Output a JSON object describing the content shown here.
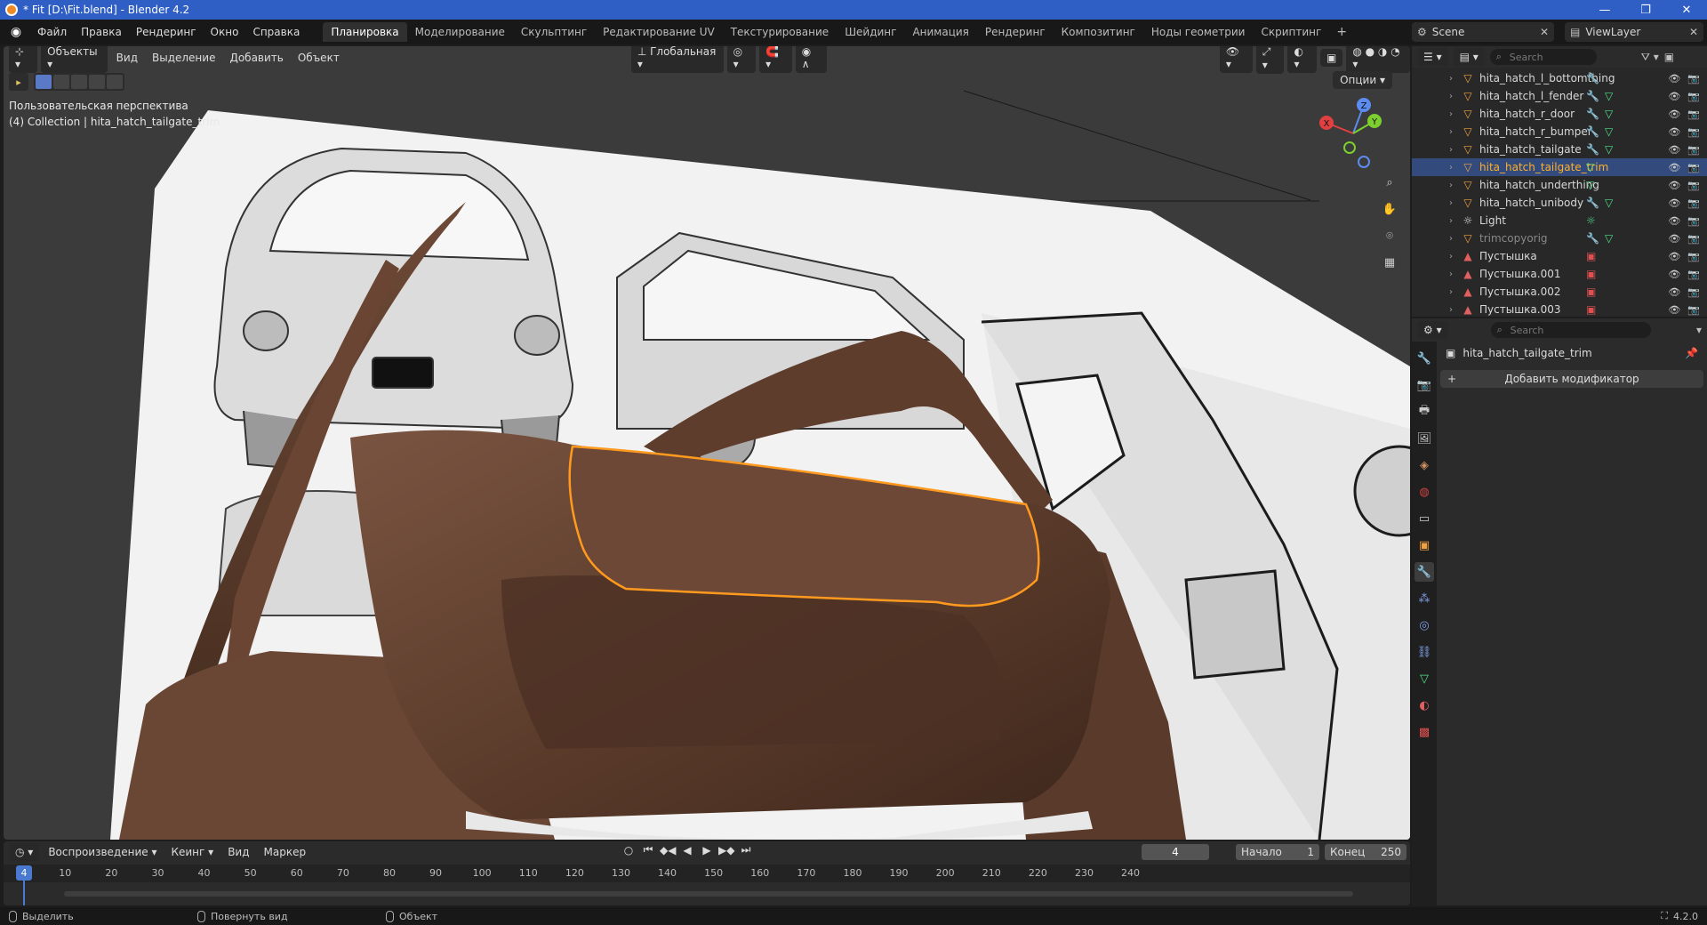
{
  "window": {
    "title": "* Fit [D:\\Fit.blend] - Blender 4.2",
    "controls": [
      "—",
      "❐",
      "✕"
    ]
  },
  "menu": [
    "Файл",
    "Правка",
    "Рендеринг",
    "Окно",
    "Справка"
  ],
  "workspaces": {
    "active": "Планировка",
    "tabs": [
      "Планировка",
      "Моделирование",
      "Скульптинг",
      "Редактирование UV",
      "Текстурирование",
      "Шейдинг",
      "Анимация",
      "Рендеринг",
      "Композитинг",
      "Ноды геометрии",
      "Скриптинг"
    ],
    "add": "+"
  },
  "scene": {
    "name": "Scene",
    "view_layer": "ViewLayer"
  },
  "viewport": {
    "mode": "Объекты",
    "menus": [
      "Вид",
      "Выделение",
      "Добавить",
      "Объект"
    ],
    "orientation": "Глобальная",
    "options": "Опции",
    "info_line1": "Пользовательская перспектива",
    "info_line2": "(4) Collection | hita_hatch_tailgate_trim",
    "gizmo": {
      "x": "X",
      "y": "Y",
      "z": "Z"
    }
  },
  "outliner": {
    "search_placeholder": "Search",
    "items": [
      {
        "name": "hita_hatch_l_bottomthing",
        "type": "mesh",
        "mods": [
          "wrench"
        ],
        "selected": false
      },
      {
        "name": "hita_hatch_l_fender",
        "type": "mesh",
        "mods": [
          "wrench",
          "mesh"
        ],
        "selected": false
      },
      {
        "name": "hita_hatch_r_door",
        "type": "mesh",
        "mods": [
          "wrench",
          "mesh"
        ],
        "selected": false
      },
      {
        "name": "hita_hatch_r_bumper",
        "type": "mesh",
        "mods": [
          "wrench",
          "mesh"
        ],
        "selected": false
      },
      {
        "name": "hita_hatch_tailgate",
        "type": "mesh",
        "mods": [
          "wrench",
          "mesh"
        ],
        "selected": false
      },
      {
        "name": "hita_hatch_tailgate_trim",
        "type": "mesh",
        "mods": [
          "mesh"
        ],
        "selected": true
      },
      {
        "name": "hita_hatch_underthing",
        "type": "mesh",
        "mods": [
          "mesh"
        ],
        "selected": false
      },
      {
        "name": "hita_hatch_unibody",
        "type": "mesh",
        "mods": [
          "wrench",
          "mesh"
        ],
        "selected": false
      },
      {
        "name": "Light",
        "type": "light",
        "mods": [
          "light"
        ],
        "selected": false
      },
      {
        "name": "trimcopyorig",
        "type": "mesh",
        "mods": [
          "wrench",
          "mesh"
        ],
        "selected": false,
        "dim": true
      },
      {
        "name": "Пустышка",
        "type": "image",
        "mods": [
          "image"
        ],
        "selected": false
      },
      {
        "name": "Пустышка.001",
        "type": "image",
        "mods": [
          "image"
        ],
        "selected": false
      },
      {
        "name": "Пустышка.002",
        "type": "image",
        "mods": [
          "image"
        ],
        "selected": false
      },
      {
        "name": "Пустышка.003",
        "type": "image",
        "mods": [
          "image"
        ],
        "selected": false
      }
    ]
  },
  "properties": {
    "search_placeholder": "Search",
    "object_name": "hita_hatch_tailgate_trim",
    "add_modifier": "Добавить модификатор"
  },
  "timeline": {
    "menus": [
      "Воспроизведение",
      "Кеинг",
      "Вид",
      "Маркер"
    ],
    "current_frame": "4",
    "start_label": "Начало",
    "start": "1",
    "end_label": "Конец",
    "end": "250",
    "ticks": [
      "10",
      "20",
      "30",
      "40",
      "50",
      "60",
      "70",
      "80",
      "90",
      "100",
      "110",
      "120",
      "130",
      "140",
      "150",
      "160",
      "170",
      "180",
      "190",
      "200",
      "210",
      "220",
      "230",
      "240"
    ]
  },
  "statusbar": {
    "select": "Выделить",
    "rotate": "Повернуть вид",
    "object": "Объект",
    "version": "4.2.0"
  },
  "colors": {
    "accent": "#4a7ad0",
    "selection": "#ffaf29",
    "title_bar": "#2f5fc4",
    "car_paint": "#6b4632"
  }
}
